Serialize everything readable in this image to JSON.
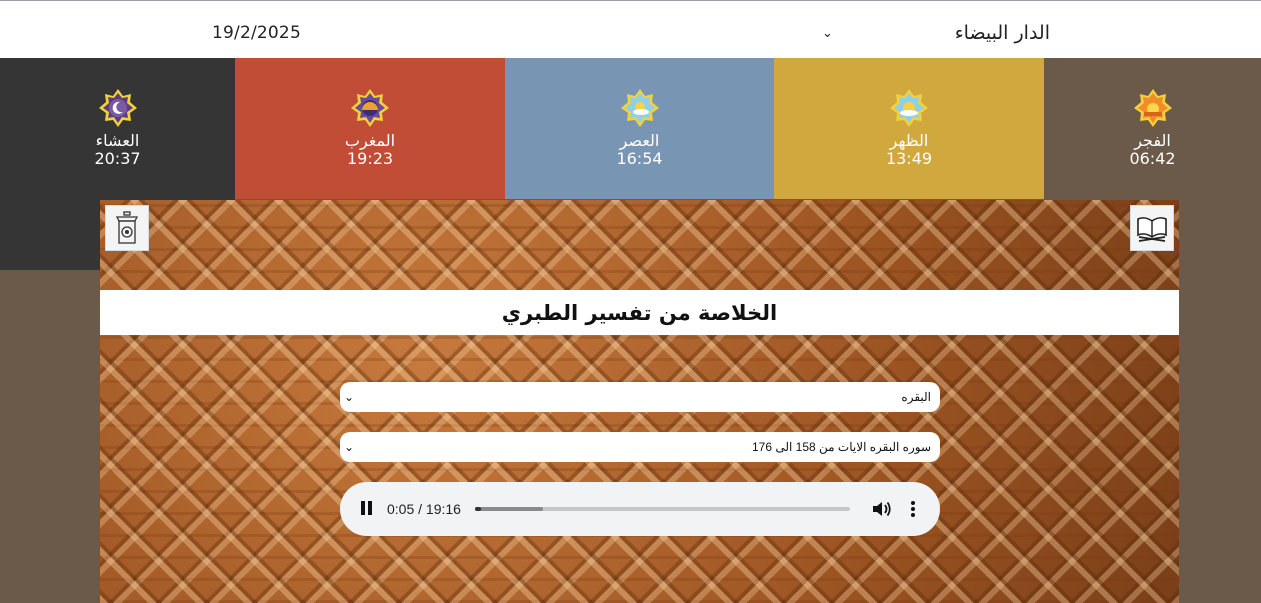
{
  "header": {
    "date": "19/2/2025",
    "city_select": {
      "selected": "الدار البيضاء",
      "icon": "chevron-down-icon"
    }
  },
  "prayers": [
    {
      "key": "isha",
      "name": "العشاء",
      "time": "20:37",
      "color": "#353535",
      "icon": "moon-star-icon"
    },
    {
      "key": "maghrib",
      "name": "المغرب",
      "time": "19:23",
      "color": "#c24d36",
      "icon": "sunset-star-icon"
    },
    {
      "key": "asr",
      "name": "العصر",
      "time": "16:54",
      "color": "#7896b4",
      "icon": "afternoon-star-icon"
    },
    {
      "key": "dhuhr",
      "name": "الظهر",
      "time": "13:49",
      "color": "#d0a83e",
      "icon": "noon-star-icon"
    },
    {
      "key": "fajr",
      "name": "الفجر",
      "time": "06:42",
      "color": "#6b5a4a",
      "icon": "sunrise-star-icon"
    }
  ],
  "panel": {
    "title": "الخلاصة من تفسير الطبري",
    "left_button_icon": "minbar-icon",
    "right_button_icon": "quran-book-icon",
    "surah_select": {
      "selected": "البقره"
    },
    "part_select": {
      "selected": "سوره البقره الايات من 158 الى 176"
    },
    "audio": {
      "current": "0:05",
      "duration": "19:16",
      "time_display": "0:05 / 19:16",
      "state": "playing",
      "played_fraction": 0.004,
      "buffered_fraction": 0.18
    }
  }
}
